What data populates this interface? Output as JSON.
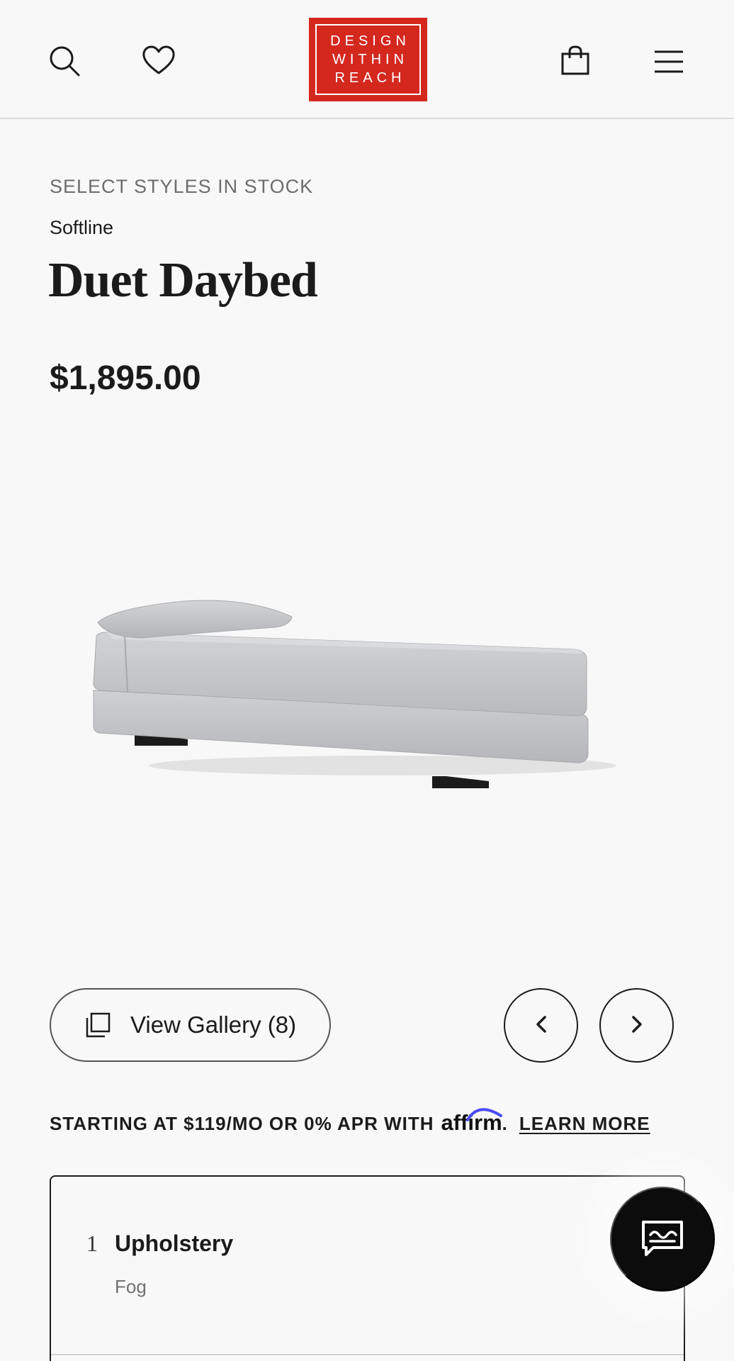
{
  "header": {
    "logo_lines": [
      "DESIGN",
      "WITHIN",
      "REACH"
    ],
    "icons": {
      "search": "search-icon",
      "wishlist": "heart-icon",
      "cart": "shopping-bag-icon",
      "menu": "hamburger-menu-icon"
    },
    "colors": {
      "logo_red": "#d4281f"
    }
  },
  "product": {
    "stock_notice": "SELECT STYLES IN STOCK",
    "brand": "Softline",
    "title": "Duet Daybed",
    "price": "$1,895.00"
  },
  "gallery": {
    "view_label": "View Gallery (8)",
    "prev_icon": "chevron-left-icon",
    "next_icon": "chevron-right-icon"
  },
  "financing": {
    "text": "STARTING AT $119/MO OR 0% APR WITH",
    "provider": "affirm",
    "period": ".",
    "link": "LEARN MORE",
    "accent": "#4a4af4"
  },
  "options": [
    {
      "number": "1",
      "name": "Upholstery",
      "value": "Fog"
    }
  ],
  "chat": {
    "icon": "chat-bubble-icon"
  }
}
